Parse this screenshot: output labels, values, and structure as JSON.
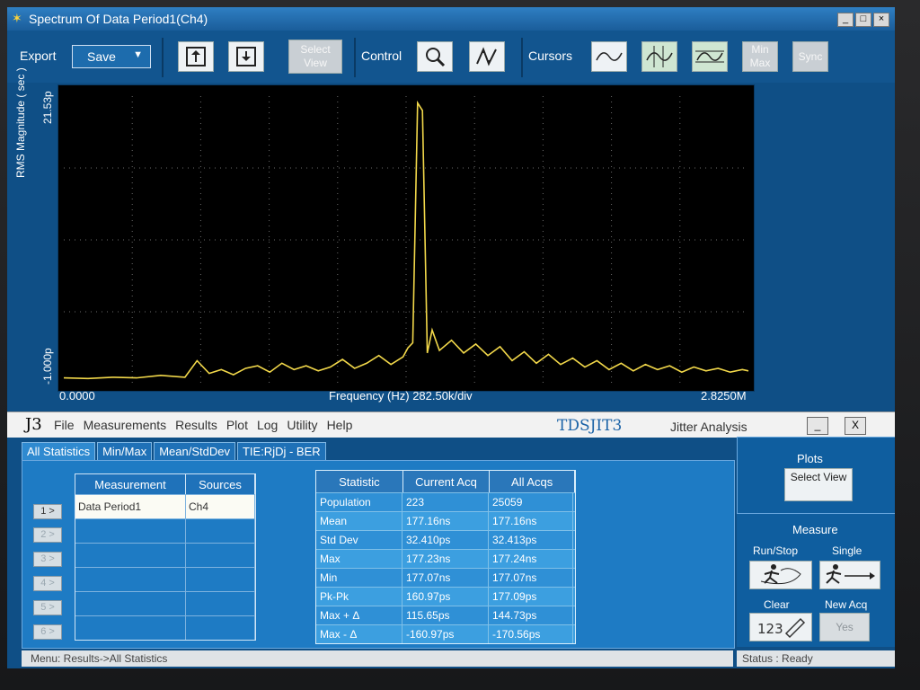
{
  "window": {
    "title": "Spectrum Of Data Period1(Ch4)",
    "min": "_",
    "max": "□",
    "close": "×"
  },
  "toolbar": {
    "export_label": "Export",
    "save_label": "Save",
    "select_view": "Select View",
    "control_label": "Control",
    "cursors_label": "Cursors",
    "minmax": "Min Max",
    "sync": "Sync"
  },
  "chart_data": {
    "type": "line",
    "ylabel": "RMS Magnitude ( sec )",
    "xlabel": "Frequency (Hz)   282.50k/div",
    "y_top_label": "21.53p",
    "y_bottom_label": "-1.000p",
    "x_left_label": "0.0000",
    "x_right_label": "2.8250M",
    "xlim": [
      0,
      2.825
    ],
    "ylim": [
      -1.0,
      21.53
    ],
    "grid": true,
    "line_color": "#f2d84a",
    "series": [
      {
        "values": [
          [
            0.0,
            -0.55
          ],
          [
            0.1,
            -0.6
          ],
          [
            0.2,
            -0.5
          ],
          [
            0.3,
            -0.55
          ],
          [
            0.4,
            -0.35
          ],
          [
            0.5,
            -0.5
          ],
          [
            0.55,
            0.8
          ],
          [
            0.6,
            -0.2
          ],
          [
            0.65,
            0.1
          ],
          [
            0.7,
            -0.3
          ],
          [
            0.75,
            0.2
          ],
          [
            0.8,
            0.4
          ],
          [
            0.85,
            -0.1
          ],
          [
            0.9,
            0.6
          ],
          [
            0.95,
            0.1
          ],
          [
            1.0,
            0.4
          ],
          [
            1.05,
            0.0
          ],
          [
            1.1,
            0.3
          ],
          [
            1.15,
            0.9
          ],
          [
            1.2,
            0.2
          ],
          [
            1.25,
            0.6
          ],
          [
            1.3,
            1.2
          ],
          [
            1.35,
            0.5
          ],
          [
            1.4,
            1.1
          ],
          [
            1.42,
            1.8
          ],
          [
            1.44,
            2.2
          ],
          [
            1.46,
            21.0
          ],
          [
            1.48,
            20.4
          ],
          [
            1.5,
            1.4
          ],
          [
            1.52,
            3.2
          ],
          [
            1.55,
            1.6
          ],
          [
            1.6,
            2.4
          ],
          [
            1.65,
            1.4
          ],
          [
            1.7,
            2.1
          ],
          [
            1.75,
            1.2
          ],
          [
            1.8,
            1.9
          ],
          [
            1.85,
            0.8
          ],
          [
            1.9,
            1.5
          ],
          [
            1.95,
            0.6
          ],
          [
            2.0,
            1.3
          ],
          [
            2.05,
            0.5
          ],
          [
            2.1,
            1.0
          ],
          [
            2.15,
            0.3
          ],
          [
            2.2,
            0.8
          ],
          [
            2.25,
            0.1
          ],
          [
            2.3,
            0.6
          ],
          [
            2.35,
            0.0
          ],
          [
            2.4,
            0.5
          ],
          [
            2.45,
            0.1
          ],
          [
            2.5,
            0.4
          ],
          [
            2.55,
            -0.1
          ],
          [
            2.6,
            0.3
          ],
          [
            2.65,
            0.0
          ],
          [
            2.7,
            0.2
          ],
          [
            2.75,
            -0.1
          ],
          [
            2.8,
            0.1
          ],
          [
            2.825,
            0.0
          ]
        ]
      }
    ]
  },
  "j3": {
    "logo": "J3",
    "menu": [
      "File",
      "Measurements",
      "Results",
      "Plot",
      "Log",
      "Utility",
      "Help"
    ],
    "brand": "TDSJIT3",
    "brand_sub": "Jitter Analysis",
    "min": "_",
    "close": "X"
  },
  "tabs": [
    "All Statistics",
    "Min/Max",
    "Mean/StdDev",
    "TIE:RjDj - BER"
  ],
  "measure_table": {
    "headers": [
      "Measurement",
      "Sources"
    ],
    "rows": [
      [
        "Data Period1",
        "Ch4"
      ],
      [
        "",
        ""
      ],
      [
        "",
        ""
      ],
      [
        "",
        ""
      ],
      [
        "",
        ""
      ],
      [
        "",
        ""
      ]
    ],
    "row_buttons": [
      "1 >",
      "2 >",
      "3 >",
      "4 >",
      "5 >",
      "6 >"
    ]
  },
  "stats_table": {
    "headers": [
      "Statistic",
      "Current Acq",
      "All Acqs"
    ],
    "rows": [
      [
        "Population",
        "223",
        "25059"
      ],
      [
        "Mean",
        "177.16ns",
        "177.16ns"
      ],
      [
        "Std Dev",
        "32.410ps",
        "32.413ps"
      ],
      [
        "Max",
        "177.23ns",
        "177.24ns"
      ],
      [
        "Min",
        "177.07ns",
        "177.07ns"
      ],
      [
        "Pk-Pk",
        "160.97ps",
        "177.09ps"
      ],
      [
        "Max + Δ",
        "115.65ps",
        "144.73ps"
      ],
      [
        "Max - Δ",
        "-160.97ps",
        "-170.56ps"
      ]
    ]
  },
  "right_panel": {
    "plots_title": "Plots",
    "select_view": "Select View",
    "measure_title": "Measure",
    "run_stop": "Run/Stop",
    "single": "Single",
    "clear": "Clear",
    "new_acq": "New Acq",
    "yes": "Yes"
  },
  "status": {
    "menu_path": "Menu: Results->All Statistics",
    "status": "Status : Ready"
  }
}
